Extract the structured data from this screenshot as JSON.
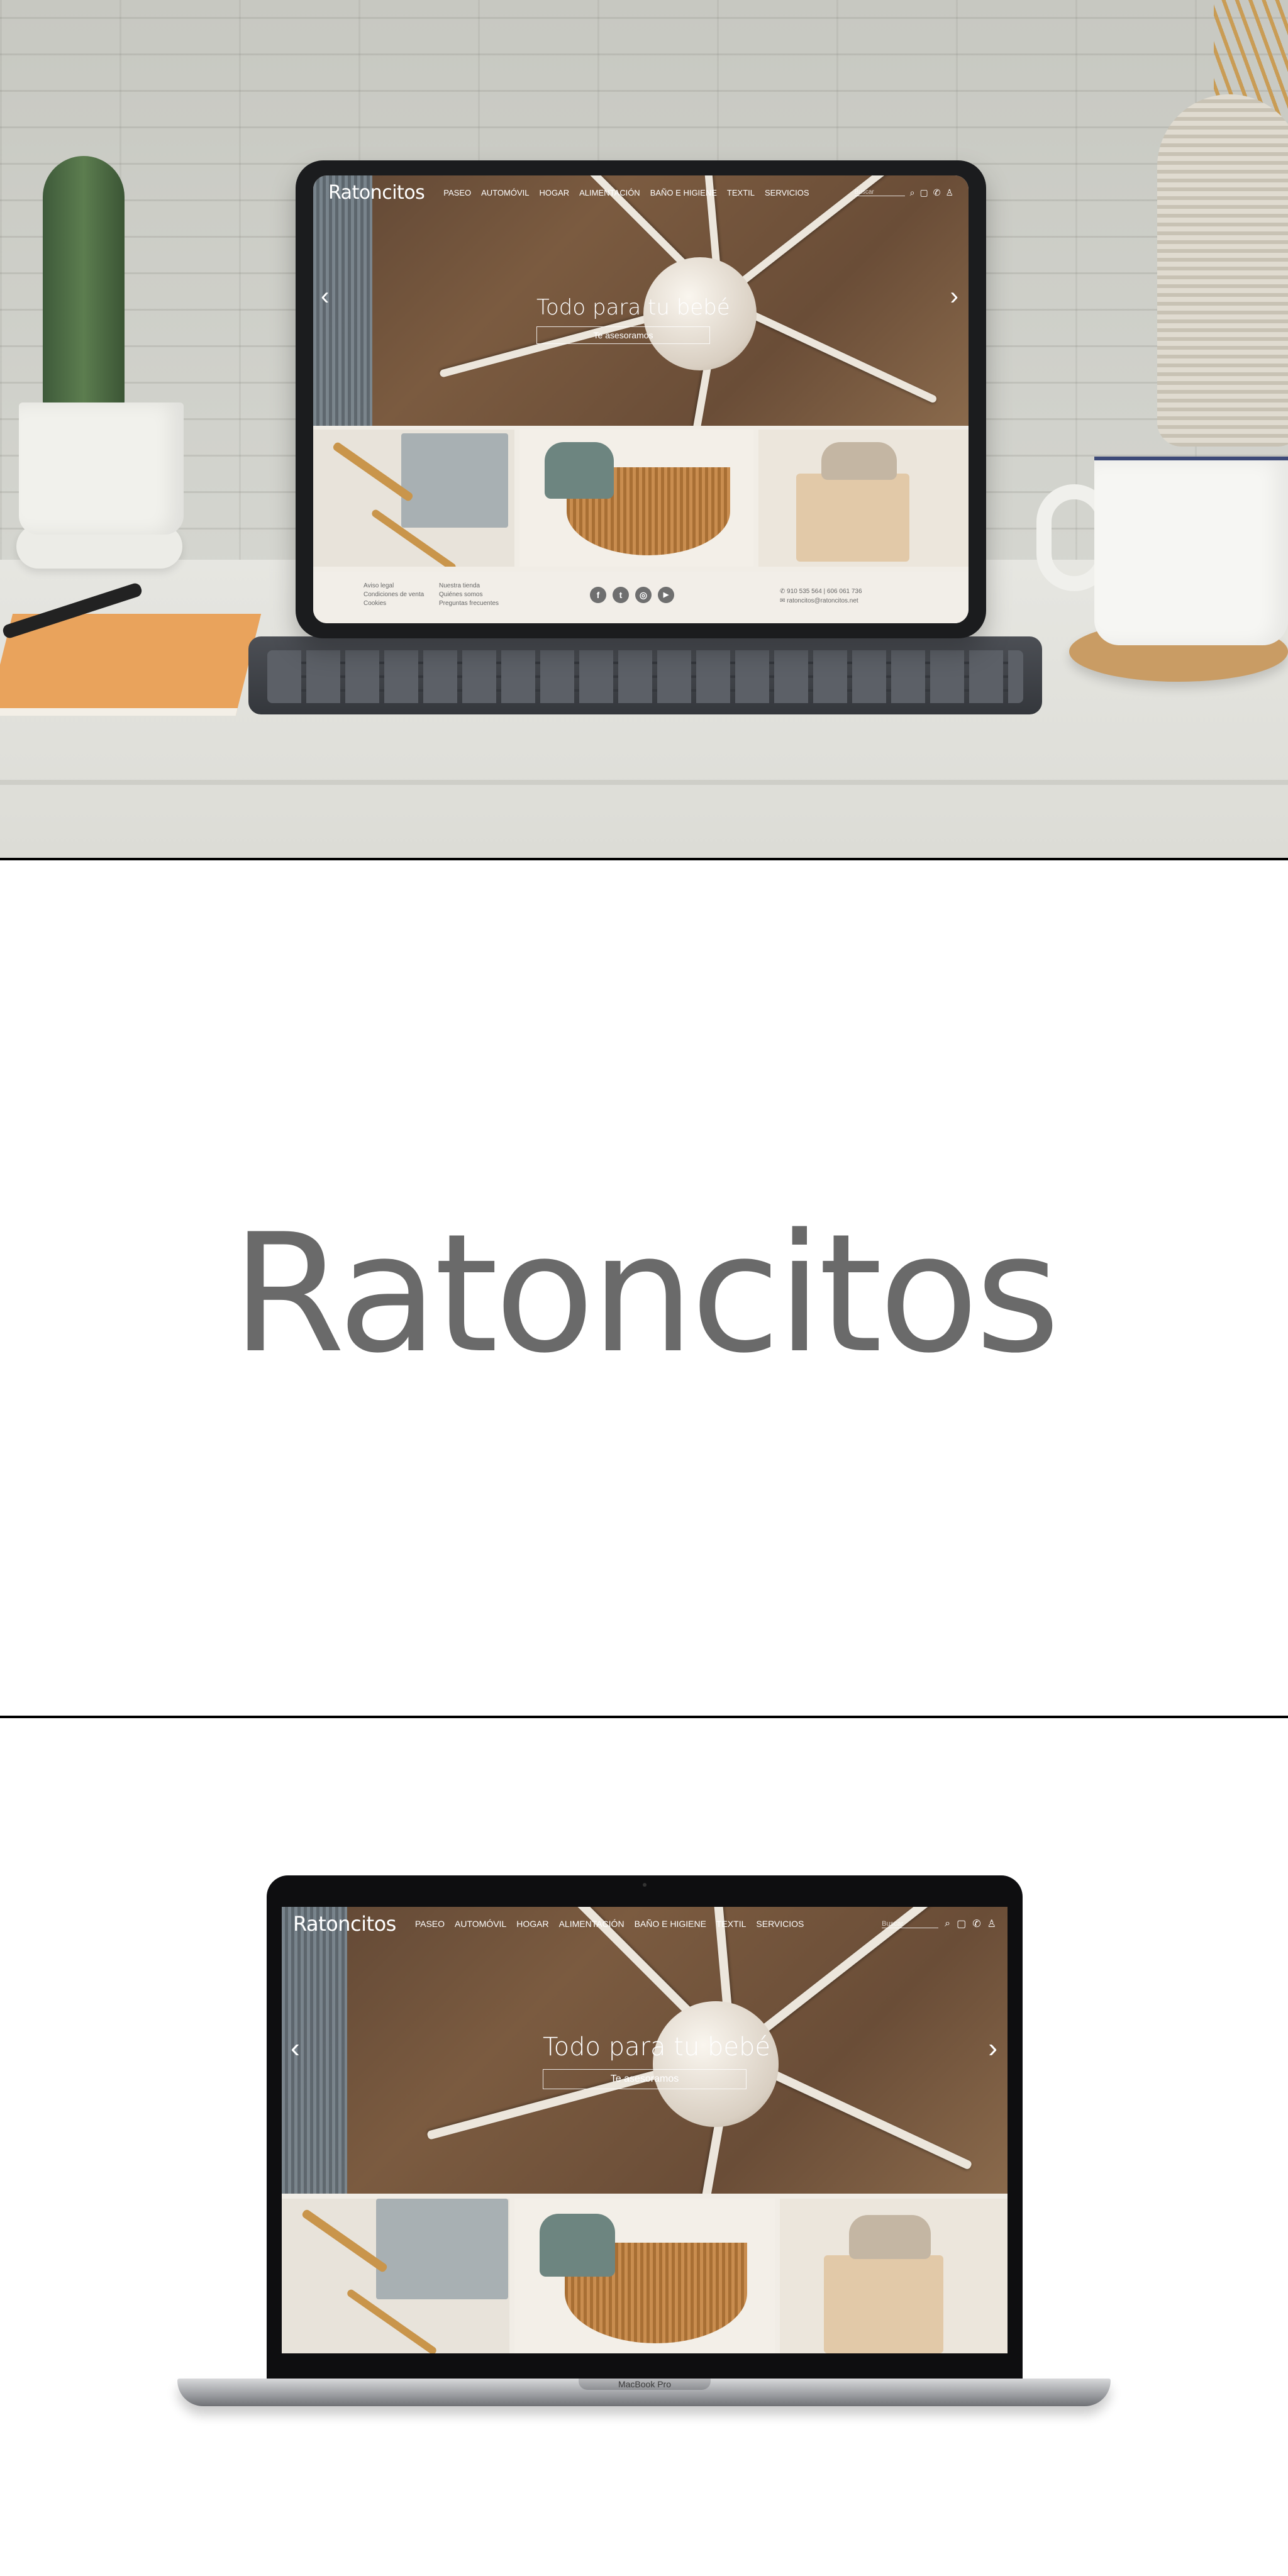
{
  "site": {
    "logo": "Ratoncitos",
    "nav": [
      "PASEO",
      "AUTOMÓVIL",
      "HOGAR",
      "ALIMENTACIÓN",
      "BAÑO E HIGIENE",
      "TEXTIL",
      "SERVICIOS"
    ],
    "search_placeholder": "Buscar",
    "headline": "Todo para tu bebé",
    "cta": "Te asesoramos",
    "arrow_prev": "‹",
    "arrow_next": "›",
    "icons": [
      "search-icon",
      "bag-icon",
      "phone-icon",
      "user-icon"
    ]
  },
  "footer": {
    "col1": [
      "Aviso legal",
      "Condiciones de venta",
      "Cookies"
    ],
    "col2": [
      "Nuestra tienda",
      "Quiénes somos",
      "Preguntas frecuentes"
    ],
    "social": [
      "f",
      "t",
      "◎",
      "▶"
    ],
    "phone": "910 535 564 | 606 061 736",
    "email": "ratoncitos@ratoncitos.net"
  },
  "brand": {
    "logo": "Ratoncitos"
  },
  "laptop": {
    "label": "MacBook Pro"
  },
  "colors": {
    "hero": "#6e5039",
    "text_logo": "#6a6a6a",
    "footer_bg": "#f2eee8"
  }
}
